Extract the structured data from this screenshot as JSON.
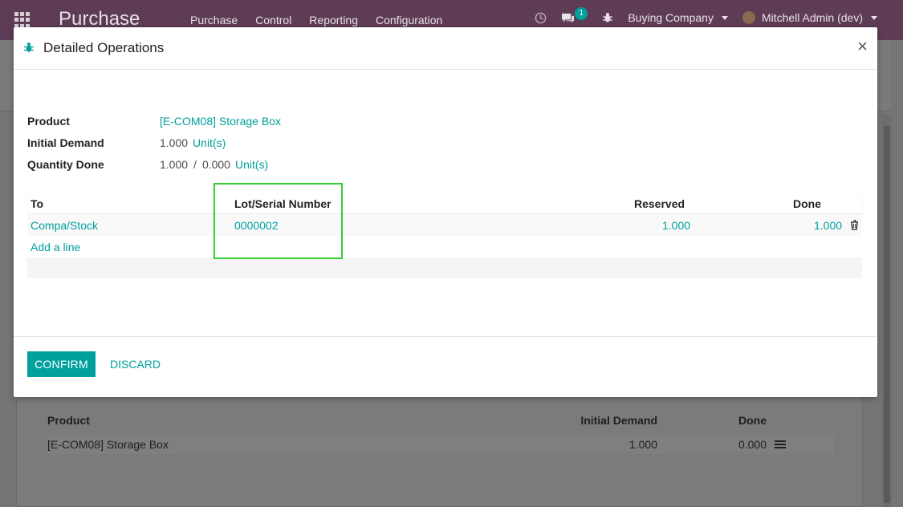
{
  "navbar": {
    "app_title": "Purchase",
    "menu": [
      "Purchase",
      "Control",
      "Reporting",
      "Configuration"
    ],
    "message_count": "1",
    "company": "Buying Company",
    "user": "Mitchell Admin (dev)"
  },
  "background_table": {
    "headers": {
      "product": "Product",
      "initial_demand": "Initial Demand",
      "done": "Done"
    },
    "rows": [
      {
        "product": "[E-COM08] Storage Box",
        "initial_demand": "1.000",
        "done": "0.000"
      }
    ]
  },
  "modal": {
    "title": "Detailed Operations",
    "fields": {
      "product_label": "Product",
      "product_value": "[E-COM08] Storage Box",
      "initial_demand_label": "Initial Demand",
      "initial_demand_value": "1.000",
      "initial_demand_uom": "Unit(s)",
      "quantity_done_label": "Quantity Done",
      "quantity_done_value": "1.000",
      "quantity_done_sep": "/",
      "quantity_done_reserved": "0.000",
      "quantity_done_uom": "Unit(s)"
    },
    "table": {
      "headers": {
        "to": "To",
        "lot": "Lot/Serial Number",
        "reserved": "Reserved",
        "done": "Done"
      },
      "rows": [
        {
          "to": "Compa/Stock",
          "lot": "0000002",
          "reserved": "1.000",
          "done": "1.000"
        }
      ],
      "add_line": "Add a line"
    },
    "buttons": {
      "confirm": "CONFIRM",
      "discard": "DISCARD"
    }
  },
  "colors": {
    "accent": "#00A09D",
    "navbar": "#5e3c55",
    "highlight": "#33cc33"
  }
}
